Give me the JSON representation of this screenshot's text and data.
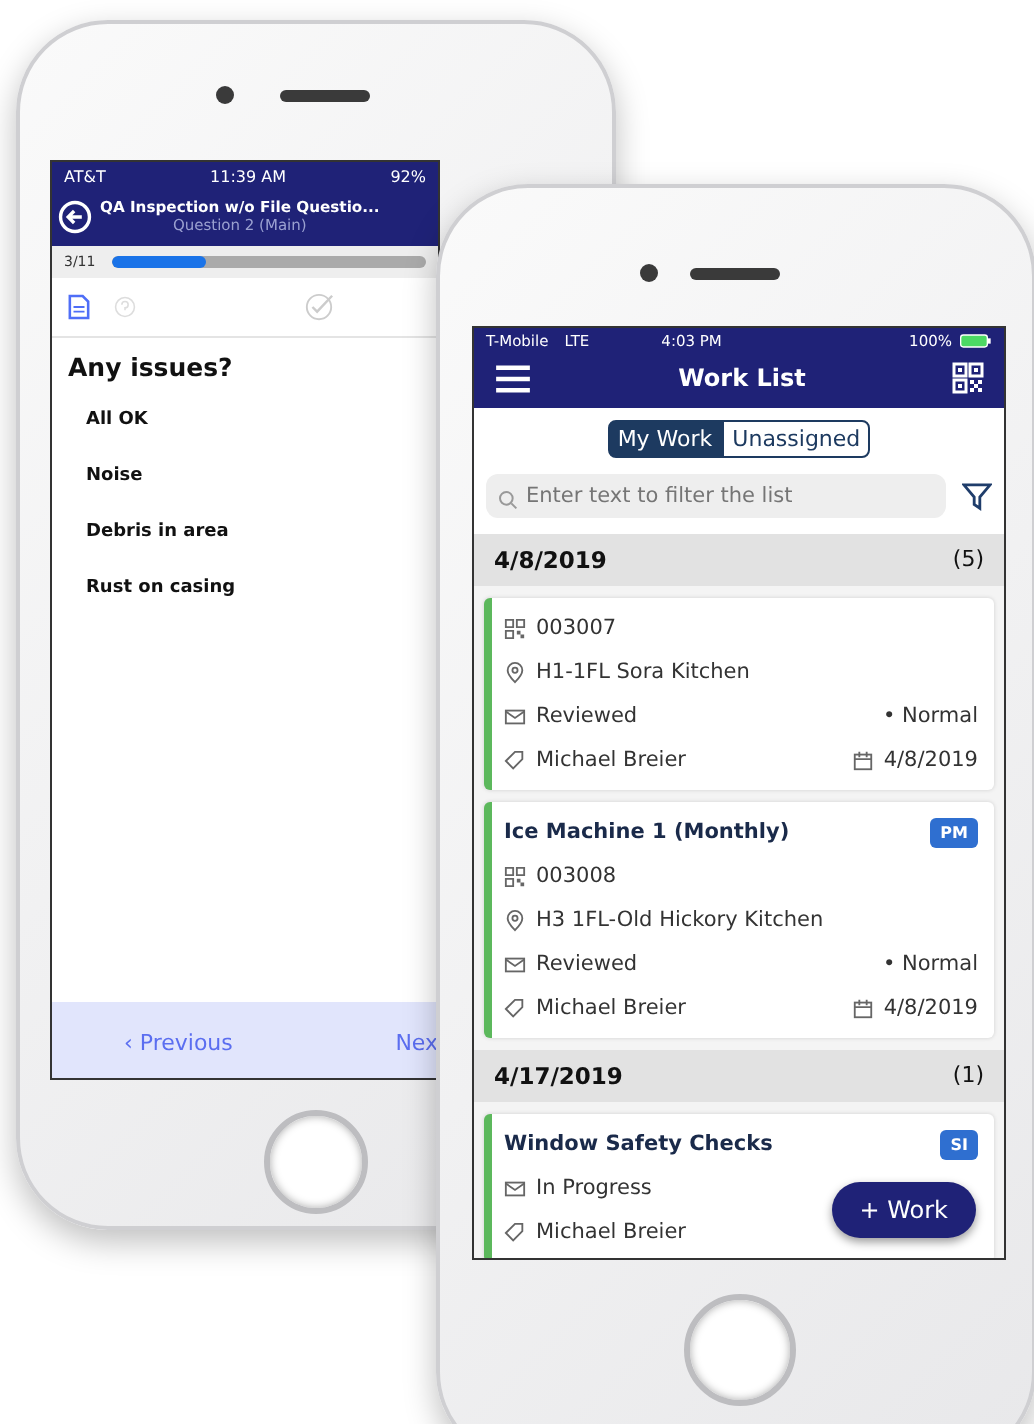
{
  "back_phone": {
    "status_bar": {
      "carrier": "AT&T",
      "time": "11:39 AM",
      "battery": "92%"
    },
    "header": {
      "title": "QA Inspection w/o File Questio...",
      "subtitle": "Question 2 (Main)"
    },
    "progress": {
      "counter": "3/11",
      "level": 0.3
    },
    "question": "Any issues?",
    "options": [
      "All OK",
      "Noise",
      "Debris in area",
      "Rust on casing"
    ],
    "footer": {
      "previous": "‹ Previous",
      "next": "Nex"
    }
  },
  "front_phone": {
    "status_bar": {
      "carrier": "T-Mobile",
      "network": "LTE",
      "time": "4:03 PM",
      "battery": "100%"
    },
    "title": "Work List",
    "tabs": [
      {
        "label": "My Work",
        "selected": true
      },
      {
        "label": "Unassigned",
        "selected": false
      }
    ],
    "search": {
      "placeholder": "Enter text to filter the list"
    },
    "groups": [
      {
        "date": "4/8/2019",
        "count": "(5)",
        "items": [
          {
            "code": "003007",
            "location": "H1-1FL Sora Kitchen",
            "status": "Reviewed",
            "priority": "• Normal",
            "assignee": "Michael Breier",
            "date": "4/8/2019"
          },
          {
            "title": "Ice Machine 1 (Monthly)",
            "badge": "PM",
            "code": "003008",
            "location": "H3 1FL-Old Hickory Kitchen",
            "status": "Reviewed",
            "priority": "• Normal",
            "assignee": "Michael Breier",
            "date": "4/8/2019"
          }
        ]
      },
      {
        "date": "4/17/2019",
        "count": "(1)",
        "items": [
          {
            "title": "Window Safety Checks",
            "badge": "SI",
            "status": "In Progress",
            "assignee": "Michael Breier"
          }
        ]
      }
    ],
    "fab": "+ Work"
  }
}
